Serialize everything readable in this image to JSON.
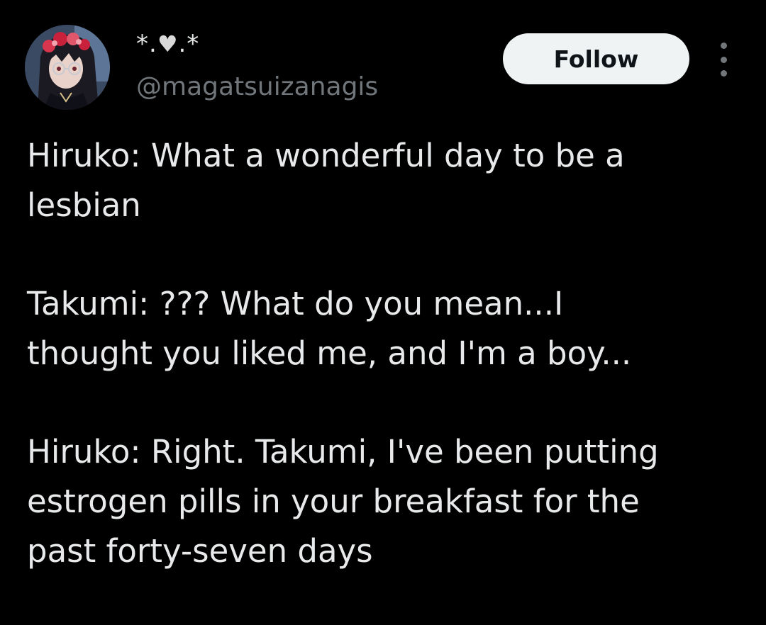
{
  "author": {
    "display_name_prefix": "*.",
    "display_name_heart": "♥",
    "display_name_suffix": ".*",
    "handle": "@magatsuizanagis",
    "avatar_icon": "anime-avatar-icon"
  },
  "actions": {
    "follow_label": "Follow",
    "more_icon": "more-vertical-icon"
  },
  "post": {
    "paragraphs": [
      {
        "lines": [
          "Hiruko: What a wonderful day to be a",
          "lesbian"
        ]
      },
      {
        "lines": [
          "Takumi: ??? What do you mean...I",
          "thought you liked me, and I'm a boy..."
        ]
      },
      {
        "lines": [
          "Hiruko: Right. Takumi, I've been putting",
          "estrogen pills in your breakfast for the",
          "past forty-seven days"
        ]
      }
    ]
  },
  "colors": {
    "background": "#000000",
    "text_primary": "#e7e9ea",
    "text_secondary": "#71767b",
    "follow_button_bg": "#eff3f4",
    "follow_button_text": "#0f1419"
  }
}
